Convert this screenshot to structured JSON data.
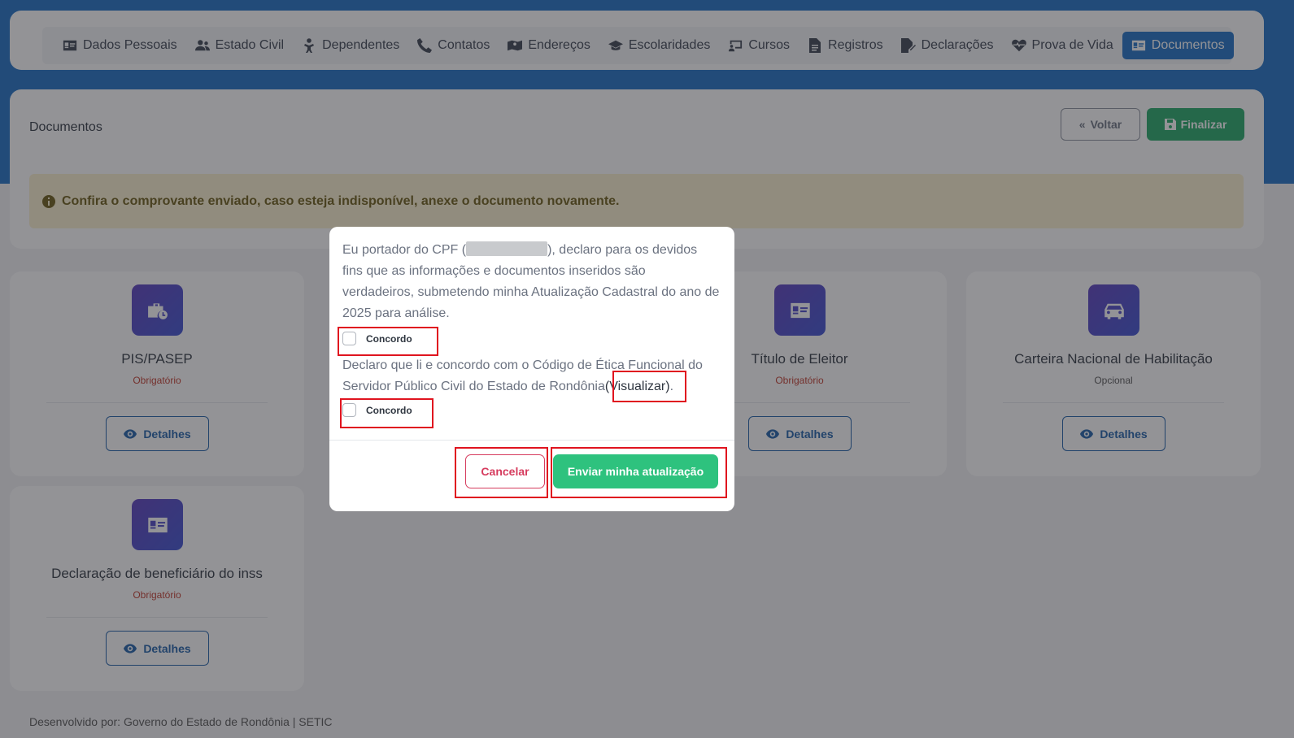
{
  "nav": {
    "items": [
      {
        "label": "Dados Pessoais",
        "icon": "id-card-icon"
      },
      {
        "label": "Estado Civil",
        "icon": "users-icon"
      },
      {
        "label": "Dependentes",
        "icon": "child-icon"
      },
      {
        "label": "Contatos",
        "icon": "phone-icon"
      },
      {
        "label": "Endereços",
        "icon": "map-icon"
      },
      {
        "label": "Escolaridades",
        "icon": "graduation-cap-icon"
      },
      {
        "label": "Cursos",
        "icon": "chalkboard-icon"
      },
      {
        "label": "Registros",
        "icon": "file-icon"
      },
      {
        "label": "Declarações",
        "icon": "file-signature-icon"
      },
      {
        "label": "Prova de Vida",
        "icon": "heart-pulse-icon"
      },
      {
        "label": "Documentos",
        "icon": "id-card-icon"
      }
    ],
    "active": "Documentos"
  },
  "page": {
    "title": "Documentos",
    "back_label": "Voltar",
    "finish_label": "Finalizar",
    "alert": "Confira o comprovante enviado, caso esteja indisponível, anexe o documento novamente."
  },
  "documents": [
    {
      "title": "PIS/PASEP",
      "requirement": "Obrigatório",
      "icon": "briefcase-clock-icon",
      "button": "Detalhes"
    },
    {
      "title": "Título de Eleitor",
      "requirement": "Obrigatório",
      "icon": "id-card-icon",
      "button": "Detalhes"
    },
    {
      "title": "Carteira Nacional de Habilitação",
      "requirement": "Opcional",
      "icon": "car-icon",
      "button": "Detalhes"
    },
    {
      "title": "Declaração de beneficiário do inss",
      "requirement": "Obrigatório",
      "icon": "id-card-icon",
      "button": "Detalhes"
    }
  ],
  "footer": "Desenvolvido por: Governo do Estado de Rondônia | SETIC",
  "modal": {
    "text1_before": "Eu portador do CPF (",
    "text1_after": "), declaro para os devidos fins que as informações e documentos inseridos são verdadeiros, submetendo minha Atualização Cadastral do ano de 2025 para análise.",
    "agree1": "Concordo",
    "text2": "Declaro que li e concordo com o Código de Ética Funcional do Servidor Público Civil do Estado de Rondônia",
    "link": "(Visualizar)",
    "link_suffix": ".",
    "agree2": "Concordo",
    "cancel": "Cancelar",
    "submit": "Enviar minha atualização"
  },
  "colors": {
    "brand_blue": "#1d6fc4",
    "success_green": "#22a866",
    "submit_green": "#2ec27e",
    "danger": "#d63c5e",
    "highlight_red": "#e0141f"
  }
}
